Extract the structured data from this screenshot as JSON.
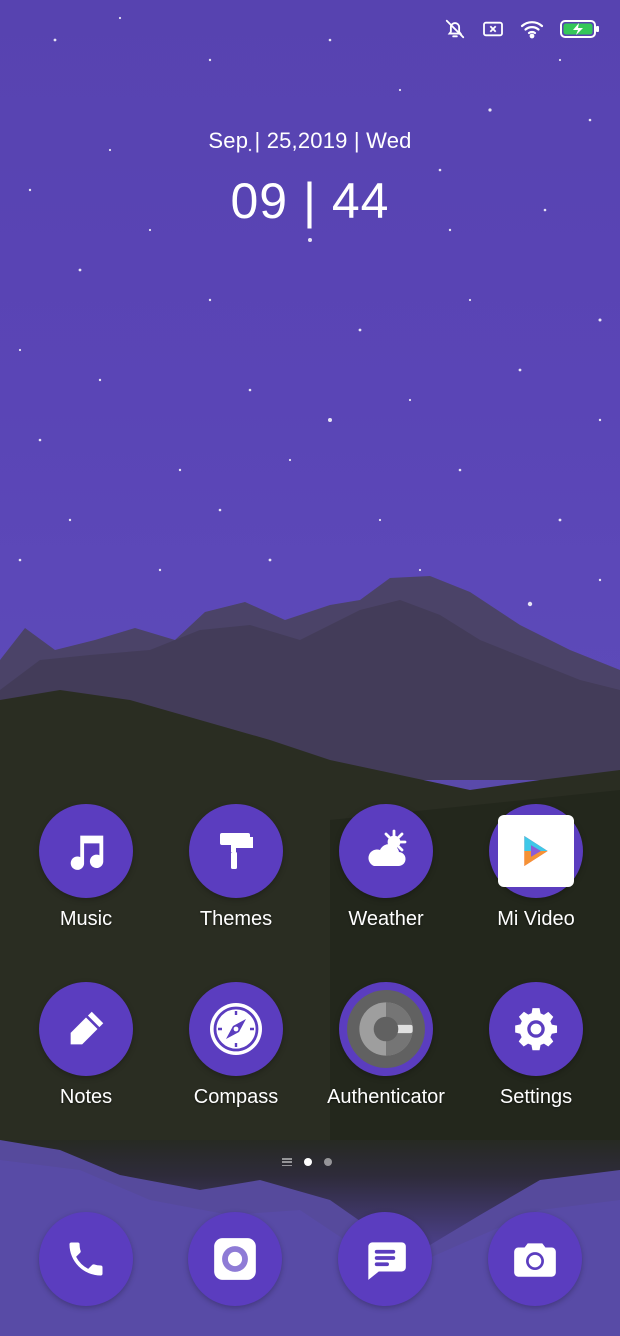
{
  "status_bar": {
    "icons": [
      "bell-off-icon",
      "no-sim-icon",
      "wifi-icon",
      "battery-charging-icon"
    ]
  },
  "lockscreen": {
    "date": "Sep | 25,2019 | Wed",
    "time": "09 | 44"
  },
  "apps": [
    {
      "label": "Music",
      "icon": "music-note-icon"
    },
    {
      "label": "Themes",
      "icon": "paint-roller-icon"
    },
    {
      "label": "Weather",
      "icon": "cloud-sun-icon"
    },
    {
      "label": "Mi Video",
      "icon": "play-icon"
    },
    {
      "label": "Notes",
      "icon": "pen-icon"
    },
    {
      "label": "Compass",
      "icon": "compass-icon"
    },
    {
      "label": "Authenticator",
      "icon": "google-authenticator-icon"
    },
    {
      "label": "Settings",
      "icon": "gear-icon"
    }
  ],
  "page_indicator": {
    "pages": 3,
    "active": 1
  },
  "dock": [
    {
      "icon": "phone-icon"
    },
    {
      "icon": "browser-icon"
    },
    {
      "icon": "messages-icon"
    },
    {
      "icon": "camera-icon"
    }
  ],
  "colors": {
    "accent": "#5b3dbf",
    "text": "#ffffff"
  }
}
